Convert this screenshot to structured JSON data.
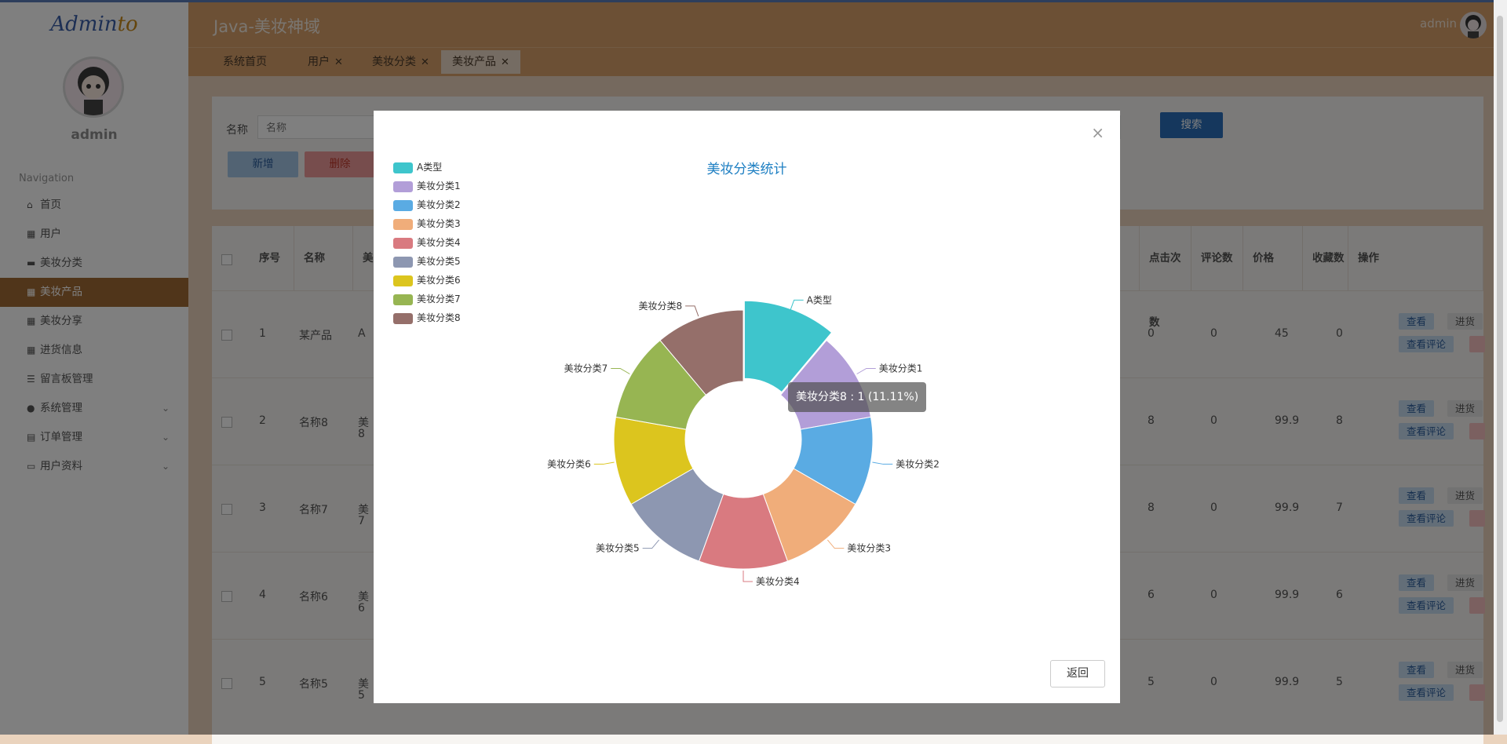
{
  "app": {
    "logo_a": "Admin",
    "logo_b": "to",
    "title": "Java-美妆神域",
    "header_user": "admin"
  },
  "sidebar": {
    "user_name": "admin",
    "nav_title": "Navigation",
    "items": [
      {
        "label": "首页",
        "icon": "home-icon"
      },
      {
        "label": "用户",
        "icon": "grid-icon"
      },
      {
        "label": "美妆分类",
        "icon": "briefcase-icon"
      },
      {
        "label": "美妆产品",
        "icon": "grid-icon",
        "active": true
      },
      {
        "label": "美妆分享",
        "icon": "grid-icon"
      },
      {
        "label": "进货信息",
        "icon": "grid-icon"
      },
      {
        "label": "留言板管理",
        "icon": "comment-icon"
      },
      {
        "label": "系统管理",
        "icon": "user-icon",
        "expand": true
      },
      {
        "label": "订单管理",
        "icon": "clipboard-icon",
        "expand": true
      },
      {
        "label": "用户资料",
        "icon": "card-icon",
        "expand": true
      }
    ]
  },
  "tabs": [
    {
      "label": "系统首页",
      "closable": false
    },
    {
      "label": "用户",
      "closable": true
    },
    {
      "label": "美妆分类",
      "closable": true
    },
    {
      "label": "美妆产品",
      "closable": true,
      "active": true
    }
  ],
  "search": {
    "label": "名称",
    "placeholder": "名称",
    "search_btn": "搜索",
    "add_btn": "新增",
    "delete_btn": "删除"
  },
  "table": {
    "headers": [
      "序号",
      "名称",
      "美",
      "点击次数",
      "评论数",
      "价格",
      "收藏数",
      "操作"
    ],
    "rows": [
      {
        "no": "1",
        "name": "某产品",
        "cat": "A",
        "cat2": "",
        "clicks": "0",
        "comments": "0",
        "price": "45",
        "favs": "0"
      },
      {
        "no": "2",
        "name": "名称8",
        "cat": "美",
        "cat2": "8",
        "clicks": "8",
        "comments": "0",
        "price": "99.9",
        "favs": "8"
      },
      {
        "no": "3",
        "name": "名称7",
        "cat": "美",
        "cat2": "7",
        "clicks": "8",
        "comments": "0",
        "price": "99.9",
        "favs": "7"
      },
      {
        "no": "4",
        "name": "名称6",
        "cat": "美",
        "cat2": "6",
        "clicks": "6",
        "comments": "0",
        "price": "99.9",
        "favs": "6"
      },
      {
        "no": "5",
        "name": "名称5",
        "cat": "美",
        "cat2": "5",
        "clicks": "5",
        "comments": "0",
        "price": "99.9",
        "favs": "5"
      }
    ],
    "actions": {
      "view": "查看",
      "stock": "进货",
      "comments": "查看评论"
    }
  },
  "modal": {
    "close": "×",
    "back_btn": "返回",
    "tooltip": "美妆分类8 : 1 (11.11%)"
  },
  "chart_data": {
    "type": "pie",
    "title": "美妆分类统计",
    "donut": true,
    "legend_position": "top-left",
    "categories": [
      "A类型",
      "美妆分类1",
      "美妆分类2",
      "美妆分类3",
      "美妆分类4",
      "美妆分类5",
      "美妆分类6",
      "美妆分类7",
      "美妆分类8"
    ],
    "values": [
      1,
      1,
      1,
      1,
      1,
      1,
      1,
      1,
      1
    ],
    "colors": [
      "#3ec5cc",
      "#b29ed8",
      "#5aabe3",
      "#f0ad7a",
      "#d97a80",
      "#8d97b1",
      "#dcc51e",
      "#97b552",
      "#956f6a"
    ],
    "emphasized": "A类型"
  }
}
